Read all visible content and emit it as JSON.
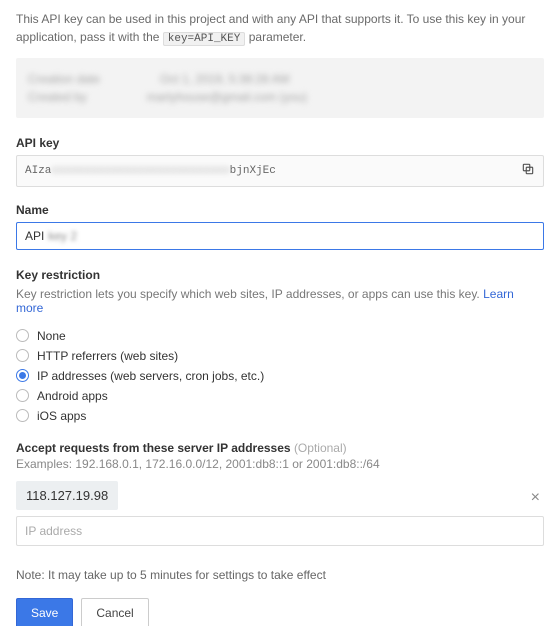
{
  "intro": {
    "part1": "This API key can be used in this project and with any API that supports it. To use this key in your application, pass it with the ",
    "code": "key=API_KEY",
    "part2": " parameter."
  },
  "meta": {
    "row1_label": "Creation date",
    "row1_value": "Oct 1, 2019, 5:38:28 AM",
    "row2_label": "Created by",
    "row2_value": "martyhouse@gmail.com (you)"
  },
  "api_key": {
    "label": "API key",
    "value_prefix": "AIza",
    "value_hidden": "xxxxxxxxxxxxxxxxxxxxxxxxxxx",
    "value_suffix": "bjnXjEc",
    "copy_icon_name": "content-copy-icon"
  },
  "name": {
    "label": "Name",
    "value_visible": "API",
    "value_hidden": "key 2"
  },
  "restriction": {
    "heading": "Key restriction",
    "help_text": "Key restriction lets you specify which web sites, IP addresses, or apps can use this key. ",
    "learn_more": "Learn more",
    "options": [
      {
        "id": "none",
        "label": "None",
        "selected": false
      },
      {
        "id": "http",
        "label": "HTTP referrers (web sites)",
        "selected": false
      },
      {
        "id": "ip",
        "label": "IP addresses (web servers, cron jobs, etc.)",
        "selected": true
      },
      {
        "id": "android",
        "label": "Android apps",
        "selected": false
      },
      {
        "id": "ios",
        "label": "iOS apps",
        "selected": false
      }
    ]
  },
  "ip_section": {
    "heading": "Accept requests from these server IP addresses",
    "optional": "(Optional)",
    "examples": "Examples: 192.168.0.1, 172.16.0.0/12, 2001:db8::1 or 2001:db8::/64",
    "chips": [
      "118.127.19.98"
    ],
    "placeholder": "IP address"
  },
  "note": "Note: It may take up to 5 minutes for settings to take effect",
  "buttons": {
    "save": "Save",
    "cancel": "Cancel"
  }
}
